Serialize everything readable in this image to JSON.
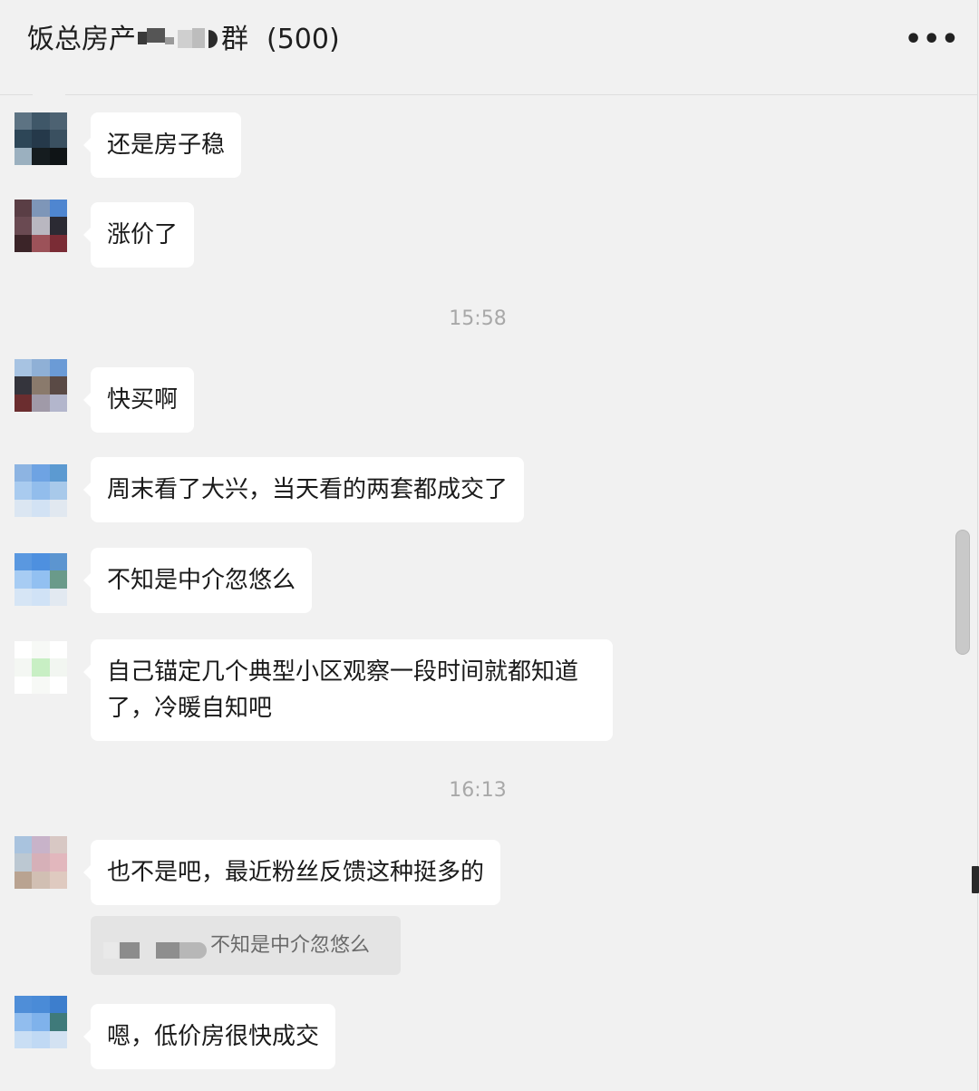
{
  "header": {
    "title_prefix": "饭总房产",
    "title_suffix": "群",
    "member_count": "(500)",
    "more_label": "•••"
  },
  "messages": [
    {
      "text": "还是房子稳"
    },
    {
      "text": "涨价了"
    },
    {
      "text": "快买啊"
    },
    {
      "text": "周末看了大兴，当天看的两套都成交了"
    },
    {
      "text": "不知是中介忽悠么"
    },
    {
      "text": "自己锚定几个典型小区观察一段时间就都知道了，冷暖自知吧"
    },
    {
      "text": "也不是吧，最近粉丝反馈这种挺多的"
    },
    {
      "text": "嗯，低价房很快成交"
    }
  ],
  "timestamps": [
    "15:58",
    "16:13"
  ],
  "quote": {
    "text": "不知是中介忽悠么"
  },
  "colors": {
    "background": "#f1f1f1",
    "bubble": "#ffffff",
    "quote_background": "#e4e4e4",
    "timestamp": "#a8a8a8"
  }
}
